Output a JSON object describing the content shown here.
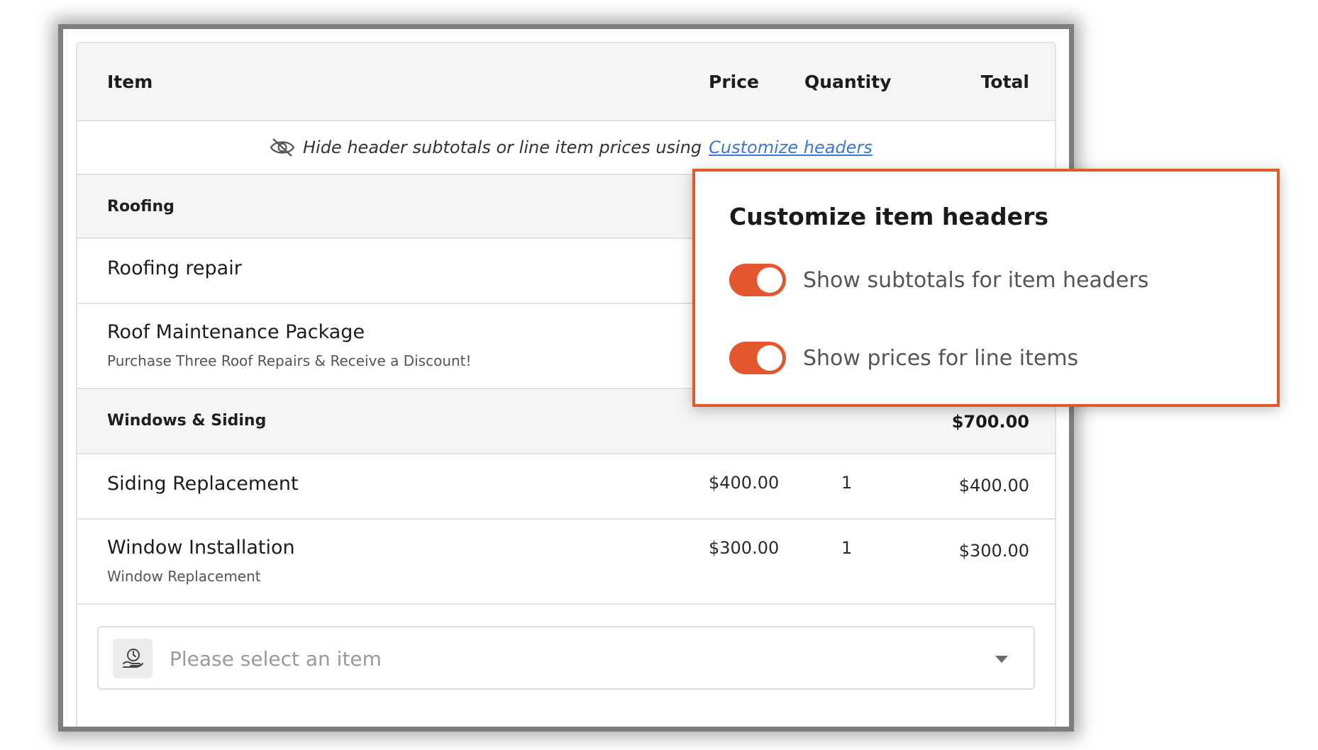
{
  "table": {
    "headers": {
      "item": "Item",
      "price": "Price",
      "quantity": "Quantity",
      "total": "Total"
    },
    "hint": {
      "text": "Hide header subtotals or line item prices using",
      "link": "Customize headers"
    },
    "groups": [
      {
        "label": "Roofing"
      },
      {
        "label": "Windows & Siding",
        "subtotal": "$700.00"
      }
    ],
    "items": [
      {
        "name": "Roofing repair"
      },
      {
        "name": "Roof Maintenance Package",
        "description": "Purchase Three Roof Repairs & Receive a Discount!"
      },
      {
        "name": "Siding Replacement",
        "price": "$400.00",
        "quantity": "1",
        "total": "$400.00"
      },
      {
        "name": "Window Installation",
        "description": "Window Replacement",
        "price": "$300.00",
        "quantity": "1",
        "total": "$300.00"
      }
    ],
    "select": {
      "placeholder": "Please select an item"
    }
  },
  "popover": {
    "title": "Customize item headers",
    "toggles": [
      {
        "label": "Show subtotals for item headers",
        "on": true
      },
      {
        "label": "Show prices for line items",
        "on": true
      }
    ]
  },
  "colors": {
    "accent": "#e4572e",
    "popover_border": "#e05a2c",
    "link": "#3a78d6"
  },
  "icons": {
    "hint": "eye-slash-icon",
    "select": "item-catalog-icon",
    "dropdown": "chevron-down-icon"
  }
}
